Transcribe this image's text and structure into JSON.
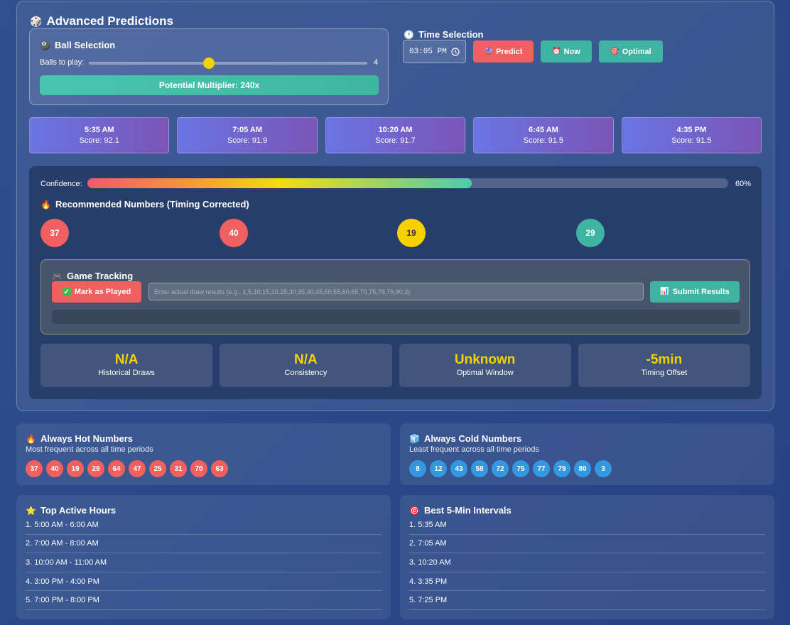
{
  "title": "Advanced Predictions",
  "ball_selection": {
    "title": "Ball Selection",
    "slider_label": "Balls to play:",
    "slider_value": "4",
    "slider_fraction": 0.43,
    "multiplier": "Potential Multiplier: 240x"
  },
  "time_selection": {
    "title": "Time Selection",
    "time_value": "03:05 PM",
    "predict_label": "Predict",
    "now_label": "Now",
    "optimal_label": "Optimal"
  },
  "optimal_times": [
    {
      "time": "5:35 AM",
      "score": "Score: 92.1"
    },
    {
      "time": "7:05 AM",
      "score": "Score: 91.9"
    },
    {
      "time": "10:20 AM",
      "score": "Score: 91.7"
    },
    {
      "time": "6:45 AM",
      "score": "Score: 91.5"
    },
    {
      "time": "4:35 PM",
      "score": "Score: 91.5"
    }
  ],
  "confidence": {
    "label": "Confidence:",
    "value": "60%",
    "fraction": 0.6
  },
  "recommended": {
    "title": "Recommended Numbers (Timing Corrected)",
    "numbers": [
      {
        "value": "37",
        "color": "#f0605e"
      },
      {
        "value": "40",
        "color": "#f0605e"
      },
      {
        "value": "19",
        "color": "#f7d000"
      },
      {
        "value": "29",
        "color": "#3fb4a3"
      }
    ]
  },
  "game_tracking": {
    "title": "Game Tracking",
    "mark_label": "Mark as Played",
    "input_placeholder": "Enter actual draw results (e.g., 1,5,10,15,20,25,30,35,40,45,50,55,60,65,70,75,78,79,80,2)",
    "submit_label": "Submit Results"
  },
  "stats": [
    {
      "value": "N/A",
      "label": "Historical Draws"
    },
    {
      "value": "N/A",
      "label": "Consistency"
    },
    {
      "value": "Unknown",
      "label": "Optimal Window"
    },
    {
      "value": "-5min",
      "label": "Timing Offset"
    }
  ],
  "hot": {
    "title": "Always Hot Numbers",
    "desc": "Most frequent across all time periods",
    "numbers": [
      "37",
      "40",
      "19",
      "29",
      "64",
      "47",
      "25",
      "31",
      "70",
      "63"
    ]
  },
  "cold": {
    "title": "Always Cold Numbers",
    "desc": "Least frequent across all time periods",
    "numbers": [
      "8",
      "12",
      "43",
      "58",
      "72",
      "75",
      "77",
      "79",
      "80",
      "3"
    ]
  },
  "active_hours": {
    "title": "Top Active Hours",
    "items": [
      "1. 5:00 AM - 6:00 AM",
      "2. 7:00 AM - 8:00 AM",
      "3. 10:00 AM - 11:00 AM",
      "4. 3:00 PM - 4:00 PM",
      "5. 7:00 PM - 8:00 PM"
    ]
  },
  "intervals": {
    "title": "Best 5-Min Intervals",
    "items": [
      "1. 5:35 AM",
      "2. 7:05 AM",
      "3. 10:20 AM",
      "4. 3:35 PM",
      "5. 7:25 PM"
    ]
  }
}
